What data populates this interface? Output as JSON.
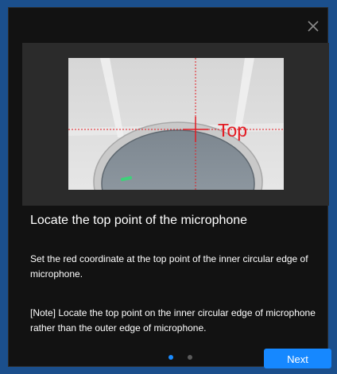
{
  "dialog": {
    "close_icon": "close-icon",
    "media": {
      "overlay_label": "Top",
      "crosshair_color": "#e31b23"
    },
    "title": "Locate the top point of the microphone",
    "description": "Set the red coordinate at the top point of the inner circular edge of microphone.",
    "note": "[Note] Locate the top point on the inner circular edge of microphone rather than the outer edge of microphone.",
    "pager": {
      "total": 2,
      "current": 1
    },
    "next_label": "Next",
    "accent_color": "#1688ff"
  }
}
